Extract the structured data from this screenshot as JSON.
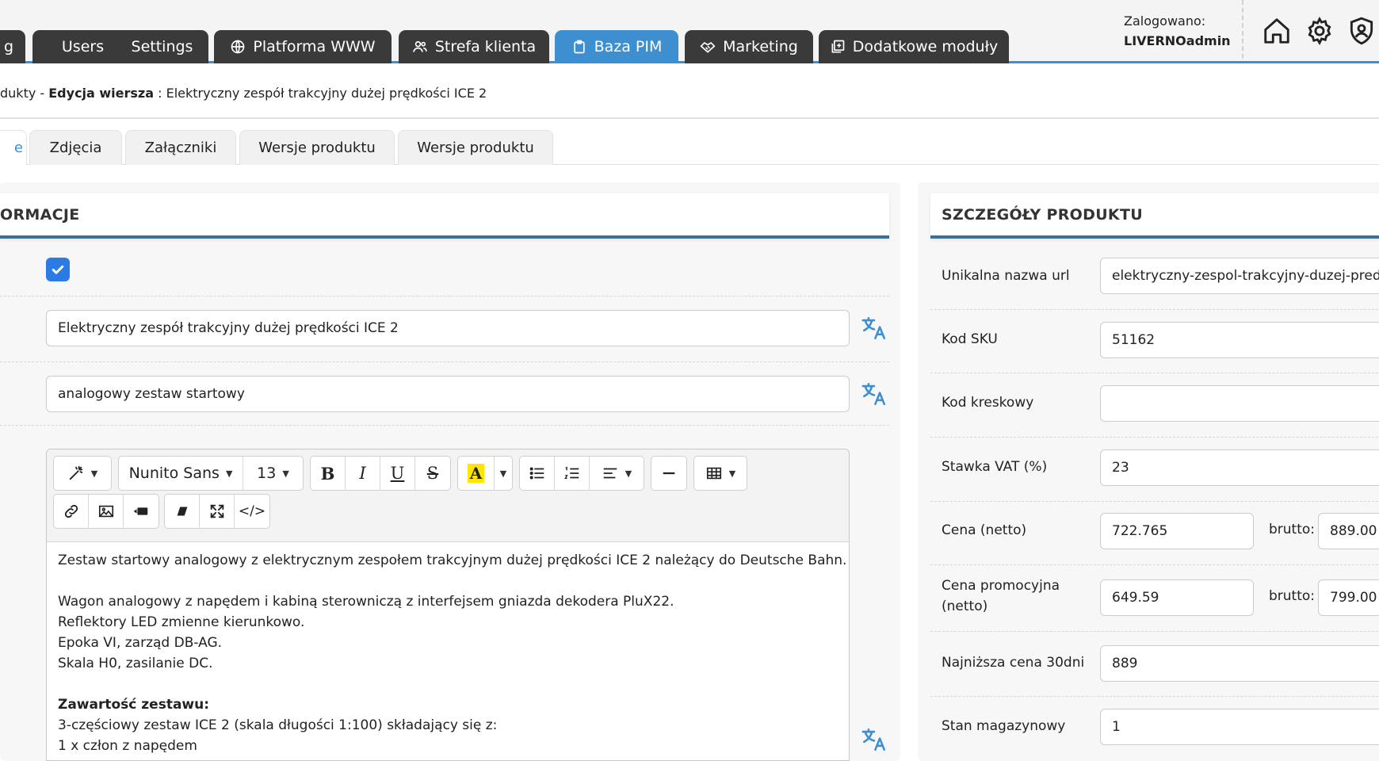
{
  "nav": {
    "tabs": [
      {
        "label": "g",
        "icon": "",
        "active": false
      },
      {
        "label": "Users",
        "icon": "",
        "active": false
      },
      {
        "label": "Settings",
        "icon": "",
        "active": false
      },
      {
        "label": "Platforma WWW",
        "icon": "globe-icon",
        "active": false
      },
      {
        "label": "Strefa klienta",
        "icon": "users-icon",
        "active": false
      },
      {
        "label": "Baza PIM",
        "icon": "clipboard-icon",
        "active": true
      },
      {
        "label": "Marketing",
        "icon": "handshake-icon",
        "active": false
      },
      {
        "label": "Dodatkowe moduły",
        "icon": "plus-square-icon",
        "active": false
      }
    ],
    "login_label": "Zalogowano:",
    "login_user": "LIVERNOadmin",
    "icons": [
      "home-icon",
      "gear-icon",
      "shield-user-icon"
    ]
  },
  "breadcrumb": {
    "prefix": "dukty - ",
    "action": "Edycja wiersza",
    "separator": " : ",
    "title": "Elektryczny zespół trakcyjny dużej prędkości ICE 2"
  },
  "subtabs": [
    "e",
    "Zdjęcia",
    "Załączniki",
    "Wersje produktu",
    "Wersje produktu"
  ],
  "left_panel": {
    "heading": "ORMACJE",
    "checkbox_checked": true,
    "name_value": "Elektryczny zespół trakcyjny dużej prędkości ICE 2",
    "subtitle_value": "analogowy zestaw startowy",
    "toolbar": {
      "font": "Nunito Sans",
      "size": "13",
      "bold": "B",
      "italic": "I",
      "underline": "U",
      "strike": "S",
      "highlight": "A",
      "code": "</>"
    },
    "content": {
      "intro": "Zestaw startowy analogowy z elektrycznym zespołem trakcyjnym dużej prędkości ICE 2 należący do Deutsche Bahn.",
      "line1": "Wagon analogowy z napędem i kabiną sterowniczą z interfejsem gniazda dekodera PluX22.",
      "line2": "Reflektory LED zmienne kierunkowo.",
      "line3": "Epoka VI, zarząd DB-AG.",
      "line4": "Skala H0, zasilanie DC.",
      "contents_heading": "Zawartość zestawu:",
      "line5": "3-częściowy zestaw ICE 2 (skala długości 1:100) składający się z:",
      "line6": "1 x człon z napędem"
    }
  },
  "right_panel": {
    "heading": "SZCZEGÓŁY PRODUKTU",
    "fields": {
      "url_label": "Unikalna nazwa url",
      "url_value": "elektryczny-zespol-trakcyjny-duzej-predk",
      "sku_label": "Kod SKU",
      "sku_value": "51162",
      "barcode_label": "Kod kreskowy",
      "barcode_value": "",
      "vat_label": "Stawka VAT (%)",
      "vat_value": "23",
      "price_label": "Cena (netto)",
      "price_value": "722.765",
      "price_brutto_label": "brutto:",
      "price_brutto_value": "889.00",
      "promo_label_1": "Cena promocyjna",
      "promo_label_2": "(netto)",
      "promo_value": "649.59",
      "promo_brutto_label": "brutto:",
      "promo_brutto_value": "799.00",
      "lowest_label": "Najniższa cena 30dni",
      "lowest_value": "889",
      "stock_label": "Stan magazynowy",
      "stock_value": "1"
    }
  },
  "colors": {
    "accent": "#3d8fd0",
    "tab_dark": "#3a3a3a",
    "checkbox": "#2c7be5",
    "section_border": "#3d6e9a",
    "translate_icon": "#3d8fd0"
  }
}
